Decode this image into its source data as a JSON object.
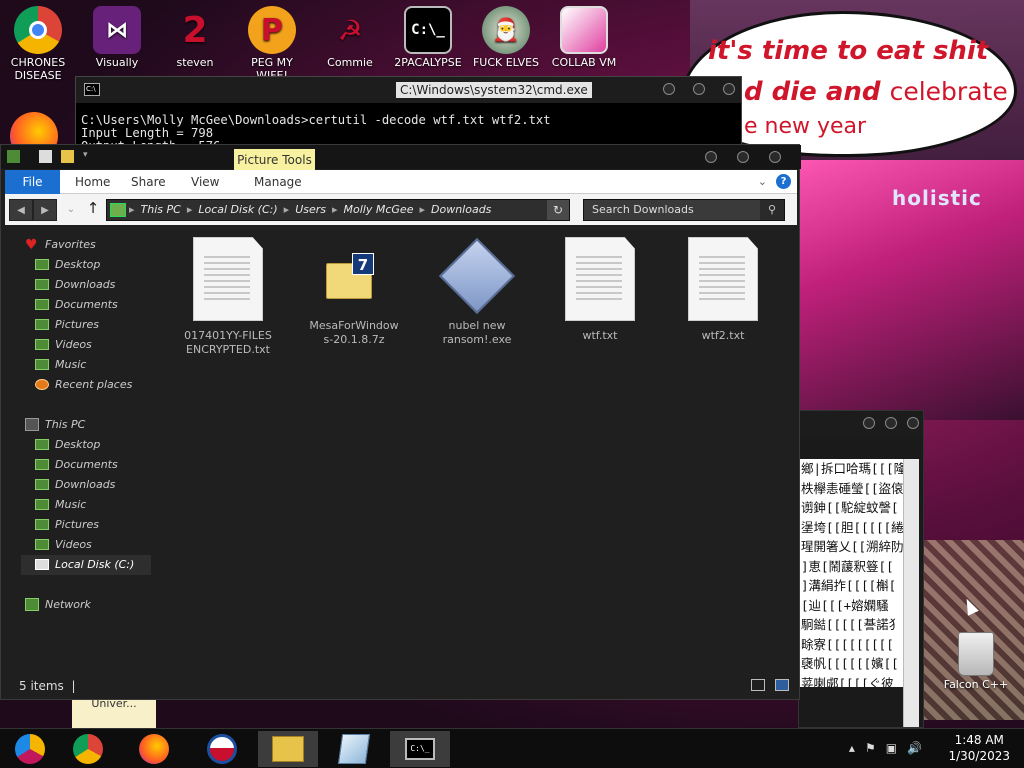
{
  "wallpaper": {
    "bubble_line1": "it's time to eat shit",
    "bubble_line2": "d die and",
    "bubble_line2b": "celebrate",
    "bubble_line3": "e new year",
    "sign_text": "holistic",
    "bubble_color": "#d0162b"
  },
  "desktop_icons": [
    {
      "label": "CHRONES DISEASE",
      "icon": "chrome-icon"
    },
    {
      "label": "Visually",
      "icon": "visual-studio-icon"
    },
    {
      "label": "steven",
      "icon": "steven-icon"
    },
    {
      "label": "PEG MY WIFE!",
      "icon": "peg-icon"
    },
    {
      "label": "Commie",
      "icon": "commie-icon"
    },
    {
      "label": "2PACALYPSE",
      "icon": "cmd-icon"
    },
    {
      "label": "FUCK ELVES",
      "icon": "elf-icon"
    },
    {
      "label": "COLLAB VM",
      "icon": "collabvm-icon"
    }
  ],
  "bottom_desktop_icons": [
    {
      "label": "Falcon C++",
      "icon": "recycle-bin-icon"
    },
    {
      "label": "Univer...",
      "icon": "folder-icon"
    }
  ],
  "cmd": {
    "title": "C:\\Windows\\system32\\cmd.exe",
    "lines": [
      "C:\\Users\\Molly McGee\\Downloads>certutil -decode wtf.txt wtf2.txt",
      "Input Length = 798",
      "Output Length = 576"
    ]
  },
  "explorer": {
    "contextual_tab": "Picture Tools",
    "tabs": [
      "File",
      "Home",
      "Share",
      "View",
      "Manage"
    ],
    "breadcrumb": [
      "This PC",
      "Local Disk (C:)",
      "Users",
      "Molly McGee",
      "Downloads"
    ],
    "search_placeholder": "Search Downloads",
    "sidebar": {
      "favorites_label": "Favorites",
      "favorites": [
        "Desktop",
        "Downloads",
        "Documents",
        "Pictures",
        "Videos",
        "Music",
        "Recent places"
      ],
      "thispc_label": "This PC",
      "thispc": [
        "Desktop",
        "Documents",
        "Downloads",
        "Music",
        "Pictures",
        "Videos",
        "Local Disk (C:)"
      ],
      "network_label": "Network"
    },
    "files": [
      {
        "name": "017401YY-FILES ENCRYPTED.txt",
        "type": "txt"
      },
      {
        "name": "MesaForWindows-20.1.8.7z",
        "type": "7z"
      },
      {
        "name": "nubel new ransom!.exe",
        "type": "exe"
      },
      {
        "name": "wtf.txt",
        "type": "txt"
      },
      {
        "name": "wtf2.txt",
        "type": "txt"
      }
    ],
    "status": "5 items",
    "ribbon_color": "#1a6fd1"
  },
  "editor": {
    "lines": [
      "鄉|拆口哈瑪[[[隆[",
      "柣欅恚硾瑩[[盜偯",
      "谫鉮[[駝綻蚊謦[",
      "塣垮[[胆[[[[[綣",
      "瑆開箸乂[[溯綷阞",
      "]恵[鬧蘐釈簦[[",
      "]溝絹拃[[[[槲[",
      "[辿[[[+嫆嫻騷",
      "駉鐑[[[[[諅諾犭",
      "畭寮[[[[[[[[[",
      "襃帆[[[[[[嬪[[",
      "荽喇郕[[[[ぐ彼"
    ]
  },
  "taskbar": {
    "time": "1:48 AM",
    "date": "1/30/2023",
    "items": [
      "chrome-canary",
      "chrome",
      "firefox",
      "obama",
      "explorer",
      "notepad",
      "cmd"
    ]
  }
}
